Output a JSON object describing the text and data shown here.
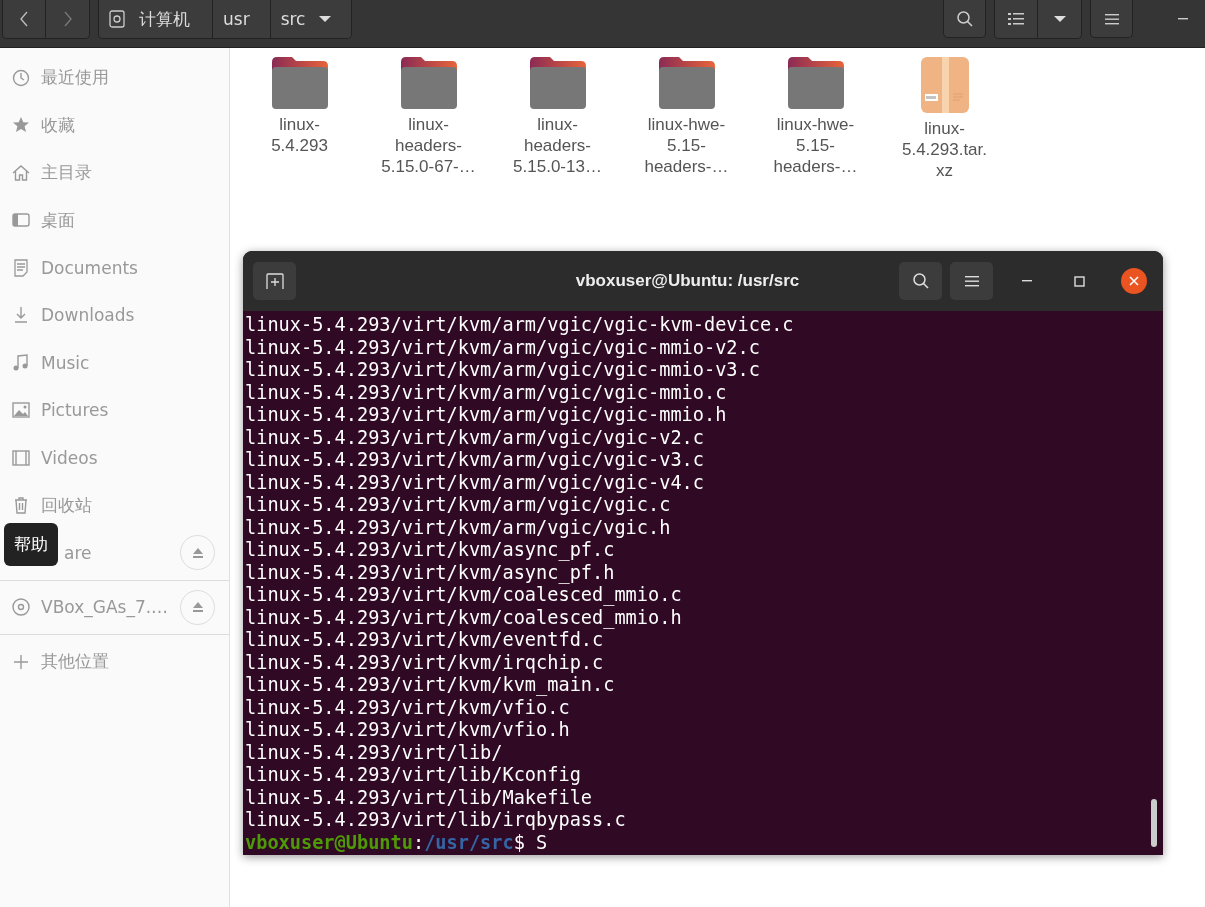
{
  "header_bar": {
    "path": [
      {
        "label": "计算机",
        "kind": "drive"
      },
      {
        "label": "usr",
        "kind": "plain"
      },
      {
        "label": "src",
        "kind": "current"
      }
    ]
  },
  "sidebar": {
    "items": [
      {
        "label": "最近使用",
        "kind": "recent",
        "eject": false
      },
      {
        "label": "收藏",
        "kind": "starred",
        "eject": false
      },
      {
        "label": "主目录",
        "kind": "home",
        "eject": false
      },
      {
        "label": "桌面",
        "kind": "desktop",
        "eject": false
      },
      {
        "label": "Documents",
        "kind": "documents",
        "eject": false
      },
      {
        "label": "Downloads",
        "kind": "downloads",
        "eject": false
      },
      {
        "label": "Music",
        "kind": "music",
        "eject": false
      },
      {
        "label": "Pictures",
        "kind": "pictures",
        "eject": false
      },
      {
        "label": "Videos",
        "kind": "videos",
        "eject": false
      },
      {
        "label": "回收站",
        "kind": "trash",
        "eject": false
      },
      {
        "label": "are",
        "kind": "covered",
        "eject": true
      },
      {
        "label": "VBox_GAs_7.…",
        "kind": "disc",
        "eject": true
      },
      {
        "label": "其他位置",
        "kind": "other",
        "eject": false
      }
    ]
  },
  "tooltip": "帮助",
  "files": [
    {
      "lines": [
        "linux-",
        "5.4.293"
      ],
      "kind": "folder"
    },
    {
      "lines": [
        "linux-",
        "headers-",
        "5.15.0-67-…"
      ],
      "kind": "folder"
    },
    {
      "lines": [
        "linux-",
        "headers-",
        "5.15.0-13…"
      ],
      "kind": "folder"
    },
    {
      "lines": [
        "linux-hwe-",
        "5.15-",
        "headers-…"
      ],
      "kind": "folder"
    },
    {
      "lines": [
        "linux-hwe-",
        "5.15-",
        "headers-…"
      ],
      "kind": "folder"
    },
    {
      "lines": [
        "linux-",
        "5.4.293.tar.",
        "xz"
      ],
      "kind": "archive"
    }
  ],
  "terminal": {
    "title": "vboxuser@Ubuntu: /usr/src",
    "lines": [
      "linux-5.4.293/virt/kvm/arm/vgic/vgic-kvm-device.c",
      "linux-5.4.293/virt/kvm/arm/vgic/vgic-mmio-v2.c",
      "linux-5.4.293/virt/kvm/arm/vgic/vgic-mmio-v3.c",
      "linux-5.4.293/virt/kvm/arm/vgic/vgic-mmio.c",
      "linux-5.4.293/virt/kvm/arm/vgic/vgic-mmio.h",
      "linux-5.4.293/virt/kvm/arm/vgic/vgic-v2.c",
      "linux-5.4.293/virt/kvm/arm/vgic/vgic-v3.c",
      "linux-5.4.293/virt/kvm/arm/vgic/vgic-v4.c",
      "linux-5.4.293/virt/kvm/arm/vgic/vgic.c",
      "linux-5.4.293/virt/kvm/arm/vgic/vgic.h",
      "linux-5.4.293/virt/kvm/async_pf.c",
      "linux-5.4.293/virt/kvm/async_pf.h",
      "linux-5.4.293/virt/kvm/coalesced_mmio.c",
      "linux-5.4.293/virt/kvm/coalesced_mmio.h",
      "linux-5.4.293/virt/kvm/eventfd.c",
      "linux-5.4.293/virt/kvm/irqchip.c",
      "linux-5.4.293/virt/kvm/kvm_main.c",
      "linux-5.4.293/virt/kvm/vfio.c",
      "linux-5.4.293/virt/kvm/vfio.h",
      "linux-5.4.293/virt/lib/",
      "linux-5.4.293/virt/lib/Kconfig",
      "linux-5.4.293/virt/lib/Makefile",
      "linux-5.4.293/virt/lib/irqbypass.c"
    ],
    "prompt": {
      "user": "vboxuser@Ubuntu",
      "separator": ":",
      "path": "/usr/src",
      "symbol": "$",
      "input": "S"
    }
  }
}
